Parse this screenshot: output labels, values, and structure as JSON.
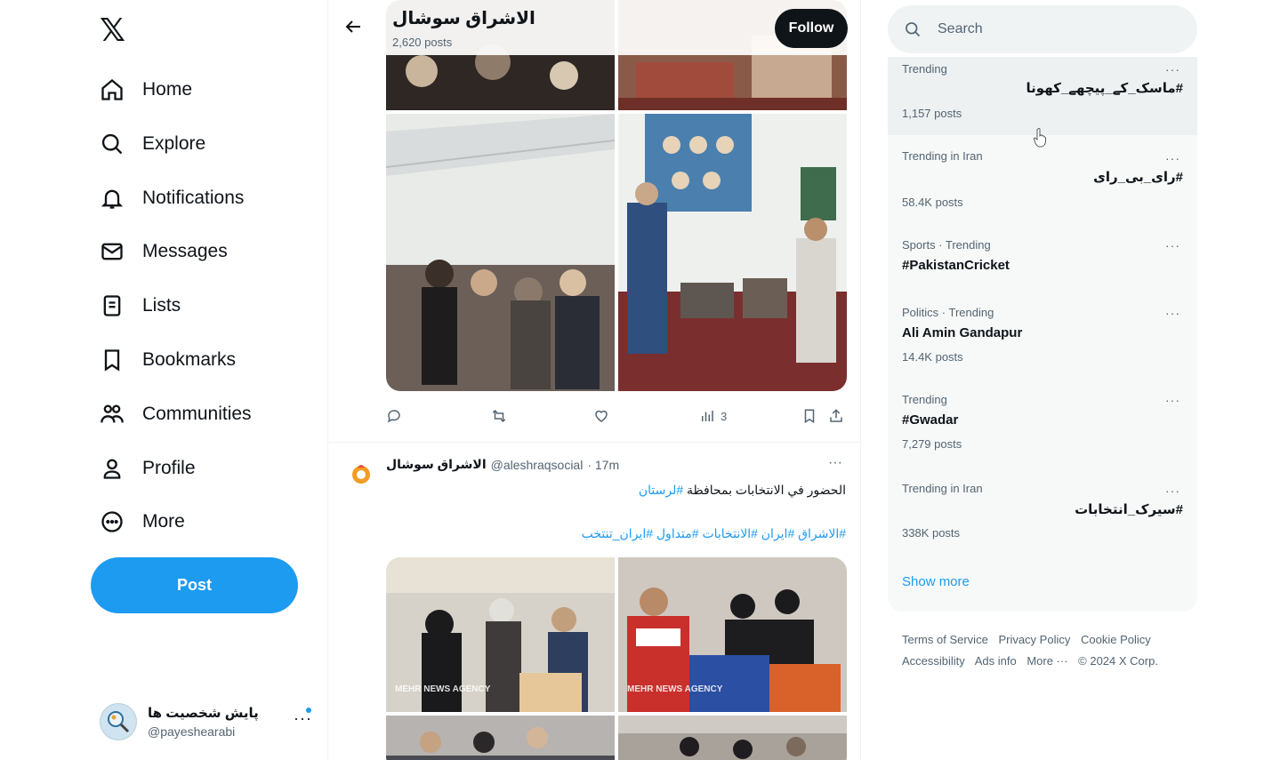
{
  "logo": "𝕏",
  "nav": {
    "items": [
      {
        "label": "Home",
        "icon": "home-icon"
      },
      {
        "label": "Explore",
        "icon": "search-icon"
      },
      {
        "label": "Notifications",
        "icon": "bell-icon"
      },
      {
        "label": "Messages",
        "icon": "mail-icon"
      },
      {
        "label": "Lists",
        "icon": "list-icon"
      },
      {
        "label": "Bookmarks",
        "icon": "bookmark-icon"
      },
      {
        "label": "Communities",
        "icon": "people-icon"
      },
      {
        "label": "Profile",
        "icon": "person-icon"
      },
      {
        "label": "More",
        "icon": "more-circle-icon"
      }
    ],
    "post_label": "Post",
    "account": {
      "display_name": "پایش شخصیت ها",
      "handle": "@payeshearabi",
      "more": "···"
    }
  },
  "header": {
    "title": "الاشراق سوشال",
    "post_count": "2,620 posts",
    "follow_label": "Follow"
  },
  "tweet1": {
    "views": "3"
  },
  "tweet2": {
    "name": "الاشراق سوشال",
    "handle": "@aleshraqsocial",
    "time": "· 17m",
    "more": "···",
    "text": "الحضور في الانتخابات بمحافظة",
    "text_tag": "#لرستان",
    "tags": "#الاشراق #ایران #الانتخابات #متداول #ایران_تنتخب",
    "watermark": "MEHR NEWS AGENCY"
  },
  "search": {
    "placeholder": "Search"
  },
  "trends": [
    {
      "meta": "Trending",
      "name": "#ماسک_کے_پیچھے_کھونا",
      "posts": "1,157 posts",
      "rtl": true
    },
    {
      "meta": "Trending in Iran",
      "name": "#رای_بی_رای",
      "posts": "58.4K posts",
      "rtl": true
    },
    {
      "meta": "Sports · Trending",
      "name": "#PakistanCricket",
      "posts": "",
      "rtl": false
    },
    {
      "meta": "Politics · Trending",
      "name": "Ali Amin Gandapur",
      "posts": "14.4K posts",
      "rtl": false
    },
    {
      "meta": "Trending",
      "name": "#Gwadar",
      "posts": "7,279 posts",
      "rtl": false
    },
    {
      "meta": "Trending in Iran",
      "name": "#سیرک_انتخابات",
      "posts": "338K posts",
      "rtl": true
    }
  ],
  "trend_more": "···",
  "show_more": "Show more",
  "footer": {
    "terms": "Terms of Service",
    "privacy": "Privacy Policy",
    "cookie": "Cookie Policy",
    "accessibility": "Accessibility",
    "ads": "Ads info",
    "more": "More ···",
    "copyright": "© 2024 X Corp."
  },
  "colors": {
    "accent": "#1d9bf0",
    "text": "#0f1419",
    "muted": "#536471",
    "panel": "#f7f9f9"
  }
}
